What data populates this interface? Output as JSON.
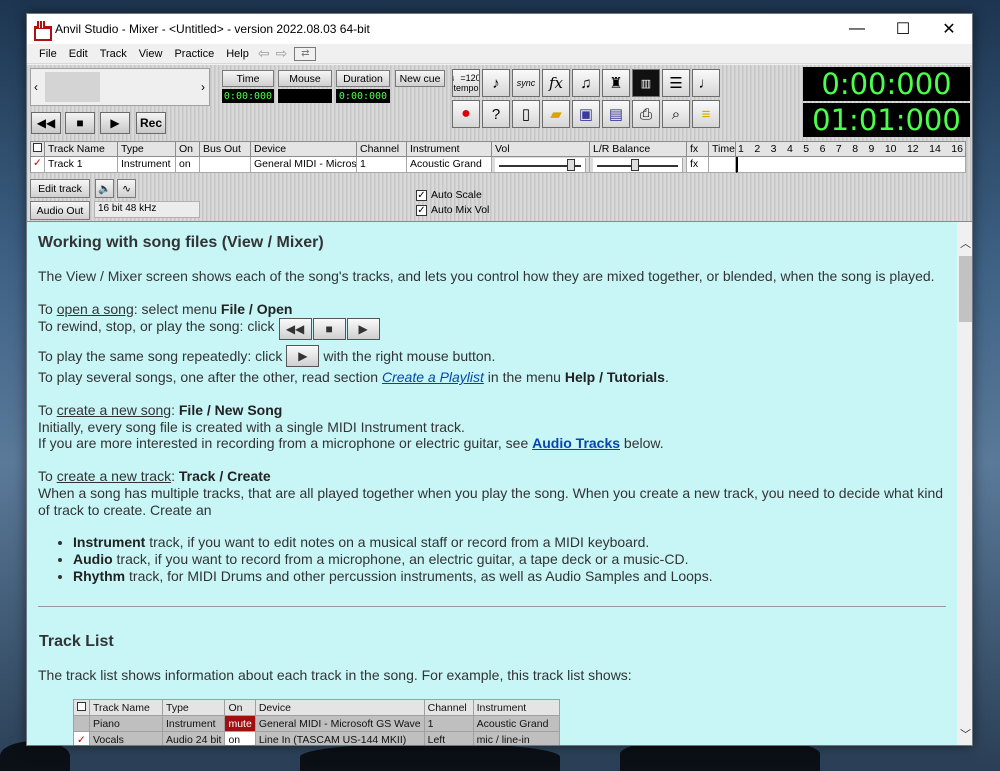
{
  "window": {
    "title": "Anvil Studio - Mixer - <Untitled> - version 2022.08.03 64-bit"
  },
  "winctl": {
    "minimize": "—",
    "maximize": "☐",
    "close": "✕"
  },
  "menu": [
    "File",
    "Edit",
    "Track",
    "View",
    "Practice",
    "Help"
  ],
  "nav": {
    "back": "⇦",
    "forward": "⇨"
  },
  "transport": {
    "rewind": "◀◀",
    "stop": "■",
    "play": "▶",
    "rec": "Rec"
  },
  "timers": {
    "time_label": "Time",
    "time_value": "0:00:000",
    "mouse_label": "Mouse",
    "mouse_value": "",
    "duration_label": "Duration",
    "duration_value": "0:00:000",
    "new_cue": "New cue"
  },
  "tempo": {
    "value": "♩=120",
    "label": "tempo"
  },
  "sync_label": "sync",
  "fx_label": "fx",
  "clock": {
    "top": "0:00:000",
    "bottom": "01:01:000"
  },
  "track_grid": {
    "headers": [
      "Track Name",
      "Type",
      "On",
      "Bus Out",
      "Device",
      "Channel",
      "Instrument",
      "Vol",
      "L/R Balance",
      "fx",
      "Time"
    ],
    "beats": [
      "1",
      "2",
      "3",
      "4",
      "5",
      "6",
      "7",
      "8",
      "9",
      "10",
      "12",
      "14",
      "16"
    ],
    "row": {
      "name": "Track 1",
      "type": "Instrument",
      "on": "on",
      "bus_out": "",
      "device": "General MIDI - Microso",
      "channel": "1",
      "instrument": "Acoustic Grand",
      "fx": "fx"
    },
    "row_checked": true,
    "vol_level": 0.95,
    "balance_level": 0.5
  },
  "controls": {
    "edit_track": "Edit track",
    "audio_out": "Audio Out",
    "audio_format": "16 bit 48 kHz",
    "auto_scale": "Auto Scale",
    "auto_mix_vol": "Auto Mix Vol",
    "auto_scale_checked": true,
    "auto_mix_vol_checked": true
  },
  "doc": {
    "heading1": "Working with song files (View / Mixer)",
    "intro": "The View / Mixer screen shows each of the song's tracks, and lets you control how they are mixed together, or blended, when the song is played.",
    "open_pre": "To ",
    "open_link": "open a song",
    "open_mid": ": select menu ",
    "open_bold": "File / Open",
    "rewind_text": "To rewind, stop, or play the song: click",
    "repeat_pre": "To play the same song repeatedly: click",
    "repeat_post": "with the right mouse button.",
    "playlist_pre": "To play several songs, one after the other, read section ",
    "playlist_link": "Create a Playlist",
    "playlist_mid": " in the menu ",
    "playlist_bold": "Help / Tutorials",
    "playlist_end": ".",
    "new_song_pre": "To ",
    "new_song_link": "create a new song",
    "new_song_mid": ": ",
    "new_song_bold": "File / New Song",
    "new_song_l1": "Initially, every song file is created with a single MIDI Instrument track.",
    "new_song_l2_pre": "If you are more interested in recording from a microphone or electric guitar, see ",
    "new_song_l2_link": "Audio Tracks",
    "new_song_l2_post": " below.",
    "new_track_pre": "To ",
    "new_track_link": "create a new track",
    "new_track_mid": ": ",
    "new_track_bold": "Track / Create",
    "new_track_body": "When a song has multiple tracks, that are all played together when you play the song. When you create a new track, you need to decide what kind of track to create. Create an",
    "bullets": [
      {
        "bold": "Instrument",
        "text": " track, if you want to edit notes on a musical staff or record from a MIDI keyboard."
      },
      {
        "bold": "Audio",
        "text": " track, if you want to record from a microphone, an electric guitar, a tape deck or a music-CD."
      },
      {
        "bold": "Rhythm",
        "text": " track, for MIDI Drums and other percussion instruments, as well as Audio Samples and Loops."
      }
    ],
    "heading2": "Track List",
    "tracklist_intro": "The track list shows information about each track in the song. For example, this track list shows:",
    "example_table": {
      "headers": [
        "Track Name",
        "Type",
        "On",
        "Device",
        "Channel",
        "Instrument"
      ],
      "rows": [
        [
          "Piano",
          "Instrument",
          "mute",
          "General MIDI - Microsoft GS Wave",
          "1",
          "Acoustic Grand"
        ],
        [
          "Vocals",
          "Audio 24 bit",
          "on",
          "Line In (TASCAM US-144 MKII)",
          "Left",
          "mic / line-in"
        ]
      ]
    }
  },
  "colors": {
    "lcd_green": "#4cff4c",
    "content_bg": "#c8f6f7",
    "link": "#0645ad",
    "mute_red": "#a01010"
  }
}
